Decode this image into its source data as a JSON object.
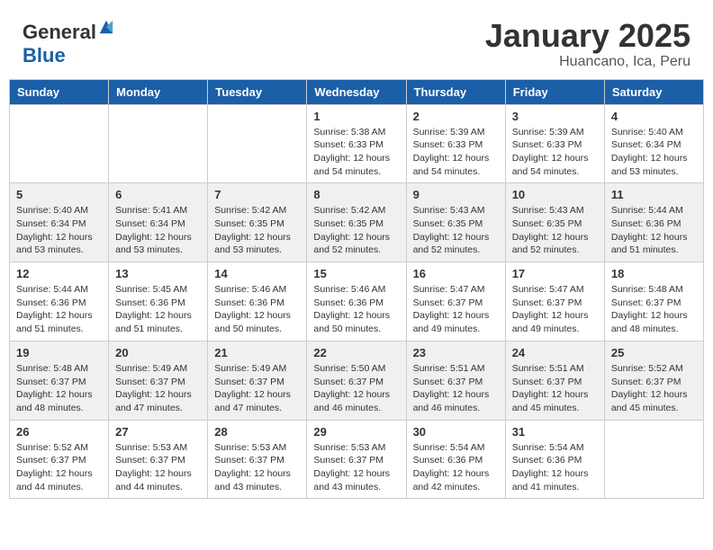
{
  "header": {
    "logo_general": "General",
    "logo_blue": "Blue",
    "month_title": "January 2025",
    "location": "Huancano, Ica, Peru"
  },
  "weekdays": [
    "Sunday",
    "Monday",
    "Tuesday",
    "Wednesday",
    "Thursday",
    "Friday",
    "Saturday"
  ],
  "weeks": [
    {
      "shaded": false,
      "days": [
        {
          "number": "",
          "empty": true
        },
        {
          "number": "",
          "empty": true
        },
        {
          "number": "",
          "empty": true
        },
        {
          "number": "1",
          "sunrise": "Sunrise: 5:38 AM",
          "sunset": "Sunset: 6:33 PM",
          "daylight": "Daylight: 12 hours and 54 minutes."
        },
        {
          "number": "2",
          "sunrise": "Sunrise: 5:39 AM",
          "sunset": "Sunset: 6:33 PM",
          "daylight": "Daylight: 12 hours and 54 minutes."
        },
        {
          "number": "3",
          "sunrise": "Sunrise: 5:39 AM",
          "sunset": "Sunset: 6:33 PM",
          "daylight": "Daylight: 12 hours and 54 minutes."
        },
        {
          "number": "4",
          "sunrise": "Sunrise: 5:40 AM",
          "sunset": "Sunset: 6:34 PM",
          "daylight": "Daylight: 12 hours and 53 minutes."
        }
      ]
    },
    {
      "shaded": true,
      "days": [
        {
          "number": "5",
          "sunrise": "Sunrise: 5:40 AM",
          "sunset": "Sunset: 6:34 PM",
          "daylight": "Daylight: 12 hours and 53 minutes."
        },
        {
          "number": "6",
          "sunrise": "Sunrise: 5:41 AM",
          "sunset": "Sunset: 6:34 PM",
          "daylight": "Daylight: 12 hours and 53 minutes."
        },
        {
          "number": "7",
          "sunrise": "Sunrise: 5:42 AM",
          "sunset": "Sunset: 6:35 PM",
          "daylight": "Daylight: 12 hours and 53 minutes."
        },
        {
          "number": "8",
          "sunrise": "Sunrise: 5:42 AM",
          "sunset": "Sunset: 6:35 PM",
          "daylight": "Daylight: 12 hours and 52 minutes."
        },
        {
          "number": "9",
          "sunrise": "Sunrise: 5:43 AM",
          "sunset": "Sunset: 6:35 PM",
          "daylight": "Daylight: 12 hours and 52 minutes."
        },
        {
          "number": "10",
          "sunrise": "Sunrise: 5:43 AM",
          "sunset": "Sunset: 6:35 PM",
          "daylight": "Daylight: 12 hours and 52 minutes."
        },
        {
          "number": "11",
          "sunrise": "Sunrise: 5:44 AM",
          "sunset": "Sunset: 6:36 PM",
          "daylight": "Daylight: 12 hours and 51 minutes."
        }
      ]
    },
    {
      "shaded": false,
      "days": [
        {
          "number": "12",
          "sunrise": "Sunrise: 5:44 AM",
          "sunset": "Sunset: 6:36 PM",
          "daylight": "Daylight: 12 hours and 51 minutes."
        },
        {
          "number": "13",
          "sunrise": "Sunrise: 5:45 AM",
          "sunset": "Sunset: 6:36 PM",
          "daylight": "Daylight: 12 hours and 51 minutes."
        },
        {
          "number": "14",
          "sunrise": "Sunrise: 5:46 AM",
          "sunset": "Sunset: 6:36 PM",
          "daylight": "Daylight: 12 hours and 50 minutes."
        },
        {
          "number": "15",
          "sunrise": "Sunrise: 5:46 AM",
          "sunset": "Sunset: 6:36 PM",
          "daylight": "Daylight: 12 hours and 50 minutes."
        },
        {
          "number": "16",
          "sunrise": "Sunrise: 5:47 AM",
          "sunset": "Sunset: 6:37 PM",
          "daylight": "Daylight: 12 hours and 49 minutes."
        },
        {
          "number": "17",
          "sunrise": "Sunrise: 5:47 AM",
          "sunset": "Sunset: 6:37 PM",
          "daylight": "Daylight: 12 hours and 49 minutes."
        },
        {
          "number": "18",
          "sunrise": "Sunrise: 5:48 AM",
          "sunset": "Sunset: 6:37 PM",
          "daylight": "Daylight: 12 hours and 48 minutes."
        }
      ]
    },
    {
      "shaded": true,
      "days": [
        {
          "number": "19",
          "sunrise": "Sunrise: 5:48 AM",
          "sunset": "Sunset: 6:37 PM",
          "daylight": "Daylight: 12 hours and 48 minutes."
        },
        {
          "number": "20",
          "sunrise": "Sunrise: 5:49 AM",
          "sunset": "Sunset: 6:37 PM",
          "daylight": "Daylight: 12 hours and 47 minutes."
        },
        {
          "number": "21",
          "sunrise": "Sunrise: 5:49 AM",
          "sunset": "Sunset: 6:37 PM",
          "daylight": "Daylight: 12 hours and 47 minutes."
        },
        {
          "number": "22",
          "sunrise": "Sunrise: 5:50 AM",
          "sunset": "Sunset: 6:37 PM",
          "daylight": "Daylight: 12 hours and 46 minutes."
        },
        {
          "number": "23",
          "sunrise": "Sunrise: 5:51 AM",
          "sunset": "Sunset: 6:37 PM",
          "daylight": "Daylight: 12 hours and 46 minutes."
        },
        {
          "number": "24",
          "sunrise": "Sunrise: 5:51 AM",
          "sunset": "Sunset: 6:37 PM",
          "daylight": "Daylight: 12 hours and 45 minutes."
        },
        {
          "number": "25",
          "sunrise": "Sunrise: 5:52 AM",
          "sunset": "Sunset: 6:37 PM",
          "daylight": "Daylight: 12 hours and 45 minutes."
        }
      ]
    },
    {
      "shaded": false,
      "days": [
        {
          "number": "26",
          "sunrise": "Sunrise: 5:52 AM",
          "sunset": "Sunset: 6:37 PM",
          "daylight": "Daylight: 12 hours and 44 minutes."
        },
        {
          "number": "27",
          "sunrise": "Sunrise: 5:53 AM",
          "sunset": "Sunset: 6:37 PM",
          "daylight": "Daylight: 12 hours and 44 minutes."
        },
        {
          "number": "28",
          "sunrise": "Sunrise: 5:53 AM",
          "sunset": "Sunset: 6:37 PM",
          "daylight": "Daylight: 12 hours and 43 minutes."
        },
        {
          "number": "29",
          "sunrise": "Sunrise: 5:53 AM",
          "sunset": "Sunset: 6:37 PM",
          "daylight": "Daylight: 12 hours and 43 minutes."
        },
        {
          "number": "30",
          "sunrise": "Sunrise: 5:54 AM",
          "sunset": "Sunset: 6:36 PM",
          "daylight": "Daylight: 12 hours and 42 minutes."
        },
        {
          "number": "31",
          "sunrise": "Sunrise: 5:54 AM",
          "sunset": "Sunset: 6:36 PM",
          "daylight": "Daylight: 12 hours and 41 minutes."
        },
        {
          "number": "",
          "empty": true
        }
      ]
    }
  ]
}
